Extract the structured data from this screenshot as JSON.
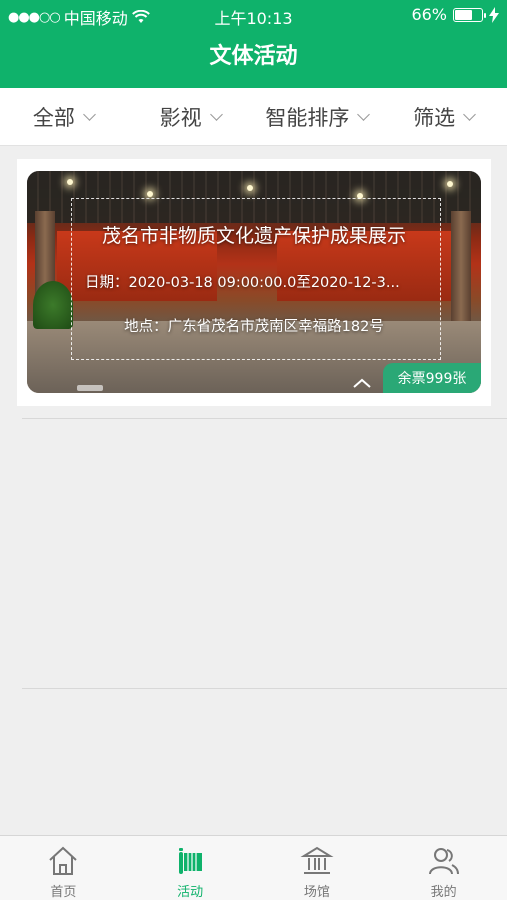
{
  "status_bar": {
    "signal_dots": "●●●○○",
    "carrier": "中国移动",
    "wifi_icon": "wifi-icon",
    "time": "上午10:13",
    "battery_percent": "66%",
    "battery_level": 0.66,
    "charging_icon": "bolt-icon"
  },
  "header": {
    "title": "文体活动",
    "color": "#0fb26b"
  },
  "filters": [
    {
      "label": "全部",
      "icon": "chevron-down-icon"
    },
    {
      "label": "影视",
      "icon": "chevron-down-icon"
    },
    {
      "label": "智能排序",
      "icon": "chevron-down-icon"
    },
    {
      "label": "筛选",
      "icon": "chevron-down-icon"
    }
  ],
  "events": [
    {
      "title": "茂名市非物质文化遗产保护成果展示",
      "date": "日期：2020-03-18 09:00:00.0至2020-12-3...",
      "location": "地点：广东省茂名市茂南区幸福路182号",
      "tickets": "余票999张"
    }
  ],
  "tabs": [
    {
      "label": "首页",
      "icon": "home-icon",
      "active": false
    },
    {
      "label": "活动",
      "icon": "activity-icon",
      "active": true
    },
    {
      "label": "场馆",
      "icon": "venue-icon",
      "active": false
    },
    {
      "label": "我的",
      "icon": "profile-icon",
      "active": false
    }
  ],
  "colors": {
    "accent": "#0fb26b",
    "badge": "#2aa876"
  }
}
